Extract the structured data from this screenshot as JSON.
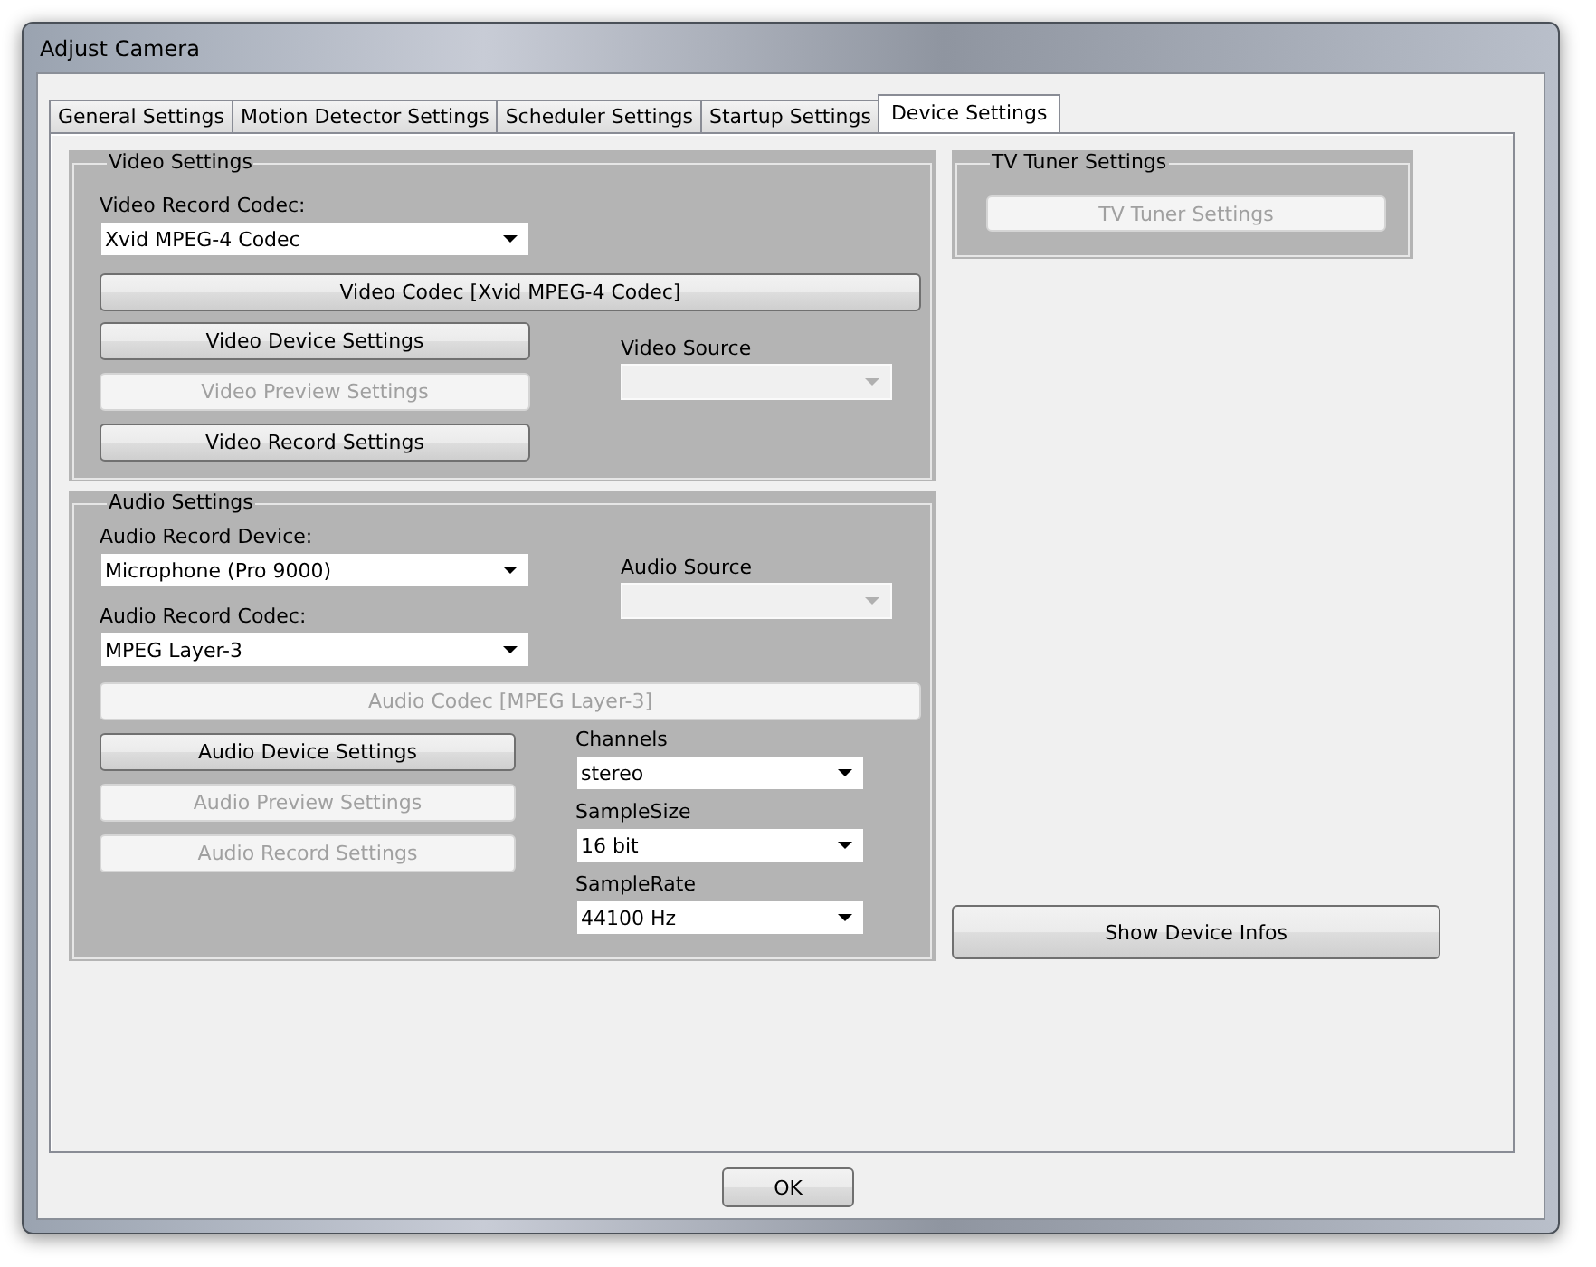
{
  "window": {
    "title": "Adjust Camera"
  },
  "tabs": [
    {
      "label": "General Settings",
      "selected": false
    },
    {
      "label": "Motion Detector Settings",
      "selected": false
    },
    {
      "label": "Scheduler Settings",
      "selected": false
    },
    {
      "label": "Startup Settings",
      "selected": false
    },
    {
      "label": "Device Settings",
      "selected": true
    }
  ],
  "video_settings": {
    "title": "Video Settings",
    "record_codec": {
      "label": "Video Record Codec:",
      "value": "Xvid MPEG-4 Codec",
      "disabled": false
    },
    "codec_button": {
      "label": "Video Codec [Xvid MPEG-4 Codec]",
      "disabled": false
    },
    "buttons": [
      {
        "label": "Video Device Settings",
        "disabled": false
      },
      {
        "label": "Video Preview Settings",
        "disabled": true
      },
      {
        "label": "Video Record Settings",
        "disabled": false
      }
    ],
    "source": {
      "label": "Video Source",
      "disabled": true
    }
  },
  "audio_settings": {
    "title": "Audio Settings",
    "record_device": {
      "label": "Audio Record Device:",
      "value": "Microphone (Pro 9000)",
      "disabled": false
    },
    "record_codec": {
      "label": "Audio Record Codec:",
      "value": "MPEG Layer-3",
      "disabled": false
    },
    "source": {
      "label": "Audio Source",
      "disabled": true
    },
    "codec_button": {
      "label": "Audio Codec [MPEG Layer-3]",
      "disabled": true
    },
    "buttons": [
      {
        "label": "Audio Device Settings",
        "disabled": false
      },
      {
        "label": "Audio Preview Settings",
        "disabled": true
      },
      {
        "label": "Audio Record Settings",
        "disabled": true
      }
    ],
    "formats": [
      {
        "label": "Channels",
        "value": "stereo",
        "disabled": false
      },
      {
        "label": "SampleSize",
        "value": "16 bit",
        "disabled": false
      },
      {
        "label": "SampleRate",
        "value": "44100 Hz",
        "disabled": false
      }
    ]
  },
  "tv_tuner": {
    "title": "TV Tuner Settings",
    "button": {
      "label": "TV Tuner Settings",
      "disabled": true
    }
  },
  "show_device_infos": {
    "label": "Show Device Infos",
    "disabled": false
  },
  "ok_button": {
    "label": "OK",
    "disabled": false
  }
}
